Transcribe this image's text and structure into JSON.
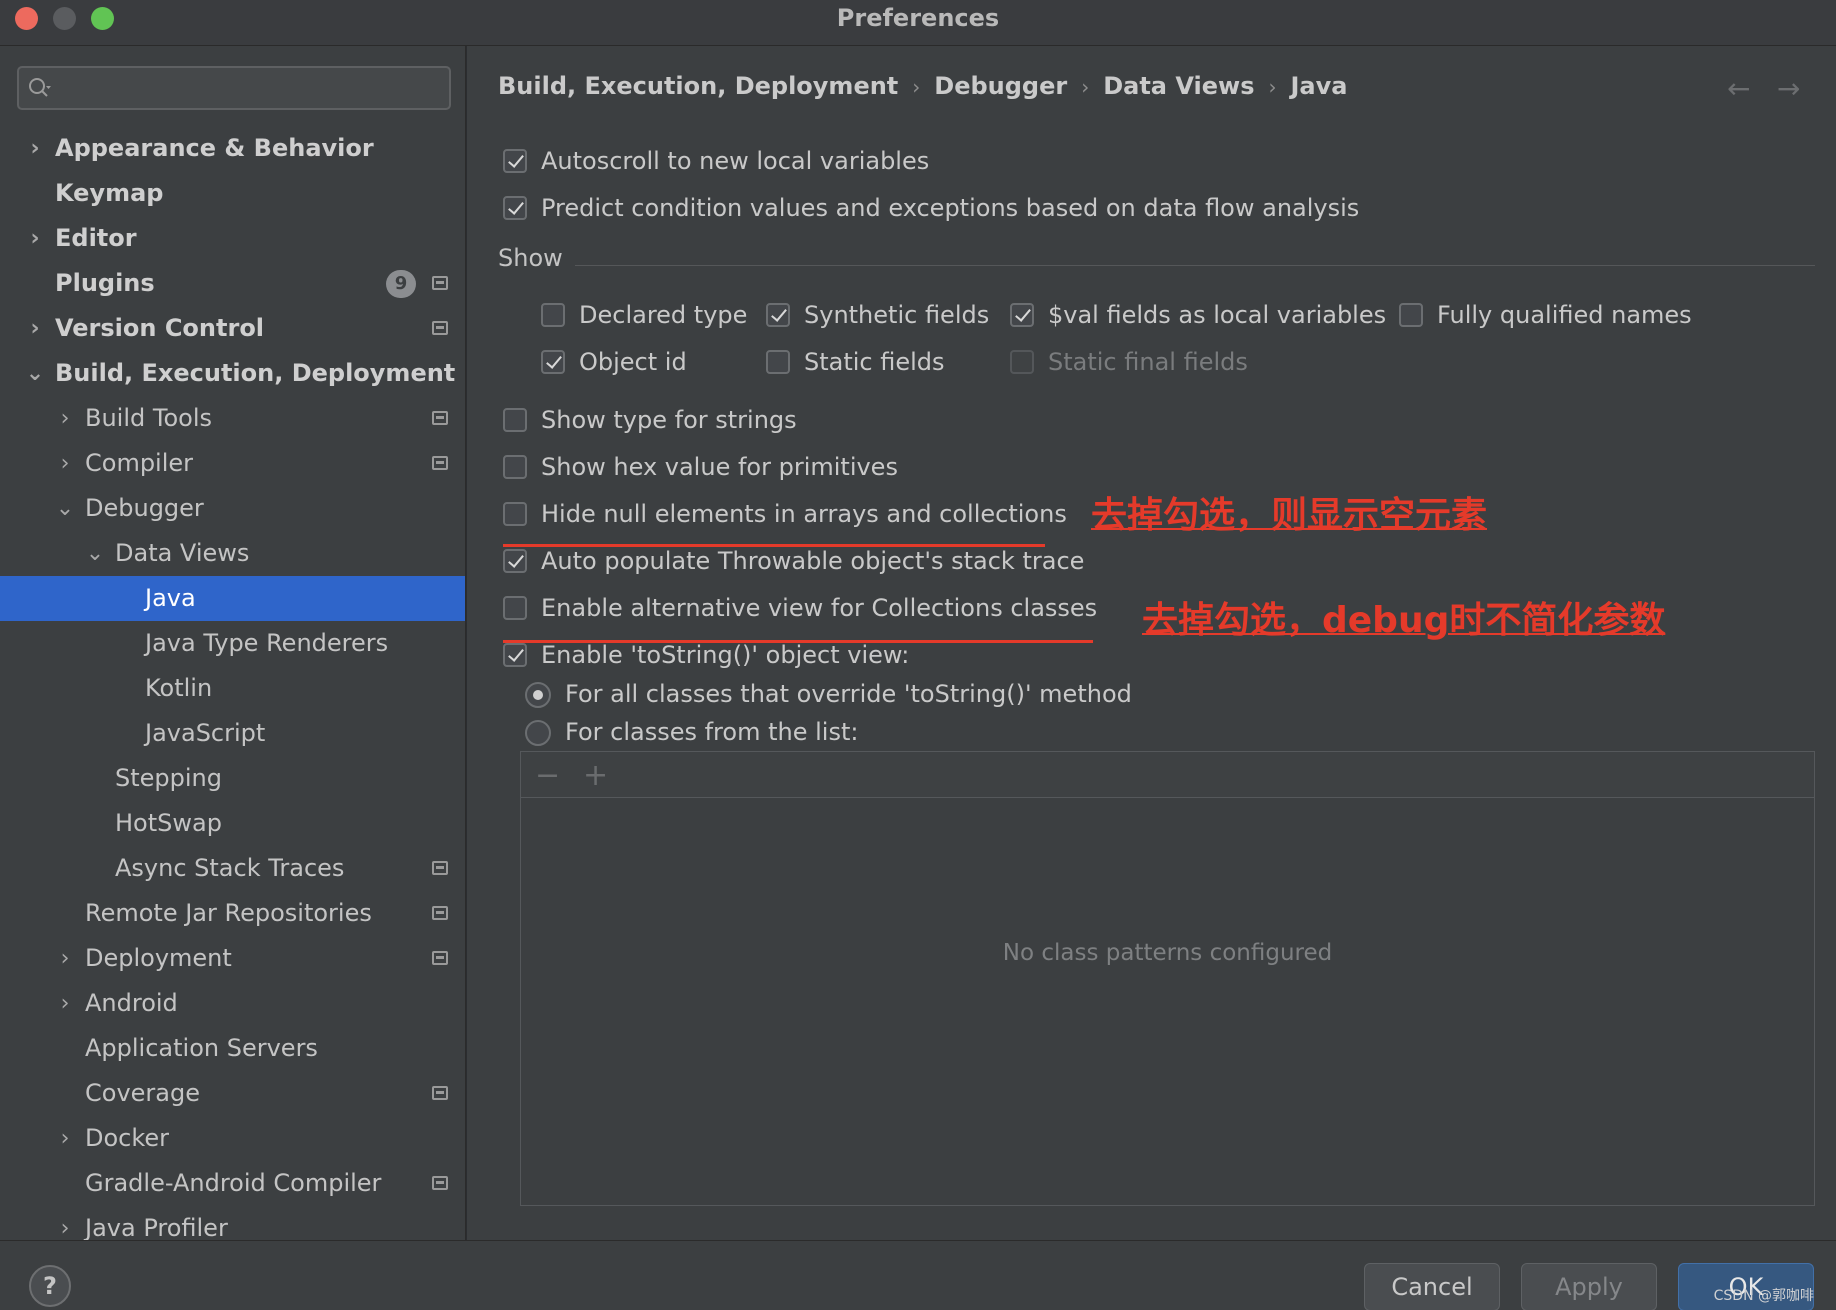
{
  "window": {
    "title": "Preferences"
  },
  "sidebar": {
    "search_placeholder": "",
    "items": [
      {
        "label": "Appearance & Behavior",
        "bold": true,
        "arrow": "›"
      },
      {
        "label": "Keymap",
        "bold": true
      },
      {
        "label": "Editor",
        "bold": true,
        "arrow": "›"
      },
      {
        "label": "Plugins",
        "bold": true,
        "badge": "9"
      },
      {
        "label": "Version Control",
        "bold": true,
        "arrow": "›"
      },
      {
        "label": "Build, Execution, Deployment",
        "bold": true,
        "arrow": "⌄"
      },
      {
        "label": "Build Tools",
        "arrow": "›"
      },
      {
        "label": "Compiler",
        "arrow": "›"
      },
      {
        "label": "Debugger",
        "arrow": "⌄"
      },
      {
        "label": "Data Views",
        "arrow": "⌄"
      },
      {
        "label": "Java",
        "selected": true
      },
      {
        "label": "Java Type Renderers"
      },
      {
        "label": "Kotlin"
      },
      {
        "label": "JavaScript"
      },
      {
        "label": "Stepping"
      },
      {
        "label": "HotSwap"
      },
      {
        "label": "Async Stack Traces"
      },
      {
        "label": "Remote Jar Repositories"
      },
      {
        "label": "Deployment",
        "arrow": "›"
      },
      {
        "label": "Android",
        "arrow": "›"
      },
      {
        "label": "Application Servers"
      },
      {
        "label": "Coverage"
      },
      {
        "label": "Docker",
        "arrow": "›"
      },
      {
        "label": "Gradle-Android Compiler"
      },
      {
        "label": "Java Profiler",
        "arrow": "›"
      }
    ]
  },
  "breadcrumb": {
    "items": [
      "Build, Execution, Deployment",
      "Debugger",
      "Data Views",
      "Java"
    ],
    "separator": "›",
    "back": "←",
    "forward": "→"
  },
  "options": {
    "autoscroll": {
      "label": "Autoscroll to new local variables",
      "checked": true
    },
    "predict": {
      "label": "Predict condition values and exceptions based on data flow analysis",
      "checked": true
    },
    "show_label": "Show",
    "declared_type": {
      "label": "Declared type",
      "checked": false
    },
    "synthetic_fields": {
      "label": "Synthetic fields",
      "checked": true
    },
    "val_fields": {
      "label": "$val fields as local variables",
      "checked": true
    },
    "fully_qualified": {
      "label": "Fully qualified names",
      "checked": false
    },
    "object_id": {
      "label": "Object id",
      "checked": true
    },
    "static_fields": {
      "label": "Static fields",
      "checked": false
    },
    "static_final_fields": {
      "label": "Static final fields",
      "checked": false,
      "disabled": true
    },
    "show_type_strings": {
      "label": "Show type for strings",
      "checked": false
    },
    "show_hex": {
      "label": "Show hex value for primitives",
      "checked": false
    },
    "hide_null": {
      "label": "Hide null elements in arrays and collections",
      "checked": false
    },
    "auto_populate": {
      "label": "Auto populate Throwable object's stack trace",
      "checked": true
    },
    "alt_view": {
      "label": "Enable alternative view for Collections classes",
      "checked": false
    },
    "tostring_view": {
      "label": "Enable 'toString()' object view:",
      "checked": true
    },
    "radio_all": {
      "label": "For all classes that override 'toString()' method",
      "checked": true
    },
    "radio_list": {
      "label": "For classes from the list:",
      "checked": false
    }
  },
  "class_list": {
    "remove": "−",
    "add": "+",
    "empty_text": "No class patterns configured"
  },
  "annotations": {
    "first": "去掉勾选，则显示空元素",
    "second": "去掉勾选，debug时不简化参数",
    "color": "#e53a2a"
  },
  "footer": {
    "help": "?",
    "cancel": "Cancel",
    "apply": "Apply",
    "ok": "OK",
    "watermark": "CSDN @郭咖啡"
  }
}
